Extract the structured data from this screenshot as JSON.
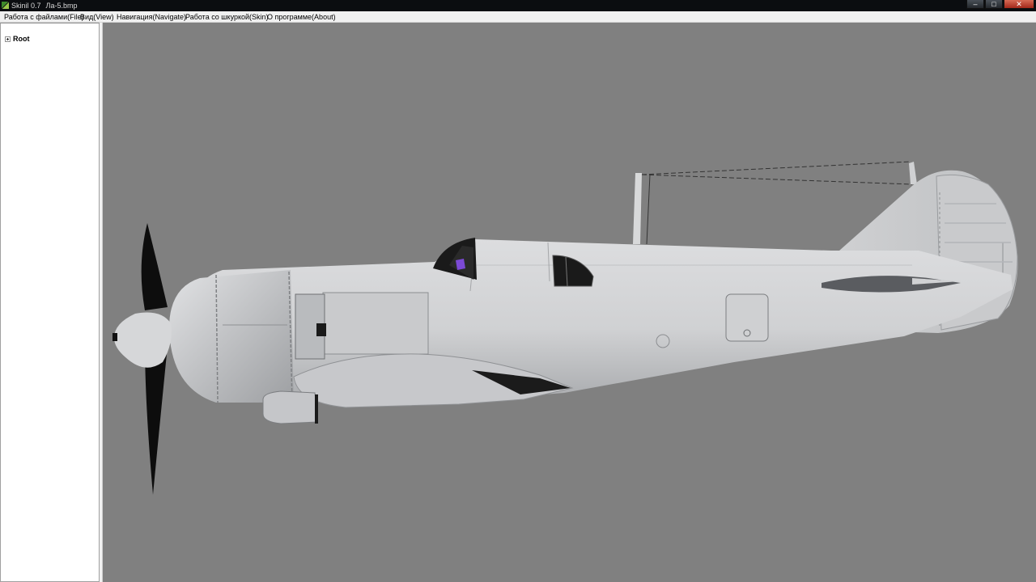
{
  "window": {
    "app_name": "Skinil 0.7",
    "file_name": "Ла-5.bmp",
    "minimize_glyph": "–",
    "maximize_glyph": "□",
    "close_glyph": "✕"
  },
  "menu": {
    "items": [
      "Работа с файлами(File)",
      "Вид(View)",
      "Навигация(Navigate)",
      "Работа со шкуркой(Skin)",
      "О программе(About)"
    ]
  },
  "tree": {
    "root_label": "Root"
  },
  "colors": {
    "viewport_bg": "#808080",
    "aircraft_body": "#d2d3d4",
    "propeller": "#0d0d0d",
    "canopy_glass": "#1a1a1a",
    "pilot_accent": "#7c4ad6"
  },
  "icons": {
    "app": "skinil-app-icon",
    "expand": "plus-box-icon"
  }
}
